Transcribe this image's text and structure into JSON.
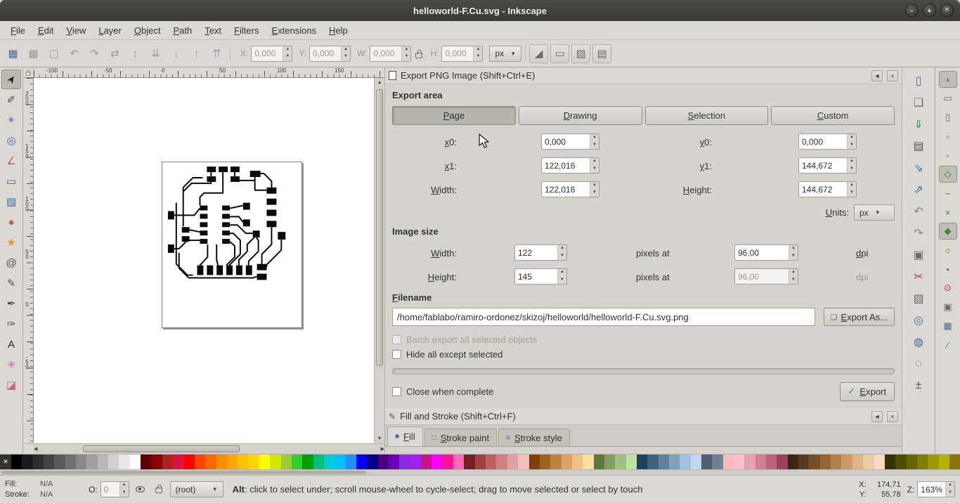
{
  "window": {
    "title": "helloworld-F.Cu.svg - Inkscape"
  },
  "titlebar": {
    "buttons": [
      {
        "name": "window-shade-button",
        "glyph": "⌄"
      },
      {
        "name": "window-maximize-button",
        "glyph": "▴"
      },
      {
        "name": "window-close-button",
        "glyph": "✕"
      }
    ]
  },
  "menu": {
    "items": [
      "File",
      "Edit",
      "View",
      "Layer",
      "Object",
      "Path",
      "Text",
      "Filters",
      "Extensions",
      "Help"
    ]
  },
  "command_bar": {
    "icons": [
      {
        "name": "select-all-icon",
        "glyph": "▦",
        "color": "#4a6a9a"
      },
      {
        "name": "select-all-layers-icon",
        "glyph": "▩",
        "color": "#9d9993"
      },
      {
        "name": "deselect-icon",
        "glyph": "▢",
        "color": "#9d9993"
      },
      {
        "name": "rotate-ccw-icon",
        "glyph": "↶",
        "color": "#9d9993"
      },
      {
        "name": "rotate-cw-icon",
        "glyph": "↷",
        "color": "#9d9993"
      },
      {
        "name": "flip-horizontal-icon",
        "glyph": "⇄",
        "color": "#9d9993"
      },
      {
        "name": "flip-vertical-icon",
        "glyph": "↕",
        "color": "#9d9993"
      },
      {
        "name": "lower-to-bottom-icon",
        "glyph": "⇊",
        "color": "#9aa4b4"
      },
      {
        "name": "lower-icon",
        "glyph": "↓",
        "color": "#9aa4b4"
      },
      {
        "name": "raise-icon",
        "glyph": "↑",
        "color": "#9aa4b4"
      },
      {
        "name": "raise-to-top-icon",
        "glyph": "⇈",
        "color": "#9aa4b4"
      }
    ],
    "x_label": "X:",
    "x_value": "0,000",
    "y_label": "Y:",
    "y_value": "0,000",
    "w_label": "W:",
    "w_value": "0,000",
    "h_label": "H:",
    "h_value": "0,000",
    "units_value": "px",
    "affect_buttons": [
      {
        "name": "transform-stroke-toggle",
        "glyph": "◢"
      },
      {
        "name": "transform-corners-toggle",
        "glyph": "▭"
      },
      {
        "name": "transform-gradient-toggle",
        "glyph": "▧"
      },
      {
        "name": "transform-pattern-toggle",
        "glyph": "▤"
      }
    ]
  },
  "toolbox": {
    "tools": [
      {
        "name": "selector-tool",
        "glyph": "➤",
        "color": "#222222",
        "active": true
      },
      {
        "name": "node-tool",
        "glyph": "✐",
        "color": "#33506a"
      },
      {
        "name": "tweak-tool",
        "glyph": "✴",
        "color": "#8a6ab0"
      },
      {
        "name": "zoom-tool",
        "glyph": "◎",
        "color": "#3a6ea5"
      },
      {
        "name": "measure-tool",
        "glyph": "∠",
        "color": "#c05a78"
      },
      {
        "name": "rectangle-tool",
        "glyph": "▭",
        "color": "#4a6a9a"
      },
      {
        "name": "box-3d-tool",
        "glyph": "▧",
        "color": "#4a6a9a"
      },
      {
        "name": "ellipse-tool",
        "glyph": "●",
        "color": "#c05a5a"
      },
      {
        "name": "star-tool",
        "glyph": "★",
        "color": "#d4a017"
      },
      {
        "name": "spiral-tool",
        "glyph": "@",
        "color": "#55524e"
      },
      {
        "name": "pencil-tool",
        "glyph": "✎",
        "color": "#55524e"
      },
      {
        "name": "pen-tool",
        "glyph": "✒",
        "color": "#55524e"
      },
      {
        "name": "calligraphy-tool",
        "glyph": "✑",
        "color": "#55524e"
      },
      {
        "name": "text-tool",
        "glyph": "A",
        "color": "#222222"
      },
      {
        "name": "spray-tool",
        "glyph": "✳",
        "color": "#b56aa0"
      },
      {
        "name": "eraser-tool",
        "glyph": "◪",
        "color": "#c06a8a"
      }
    ]
  },
  "rulers": {
    "horizontal": [
      "-100",
      "-50",
      "0",
      "50",
      "100",
      "150"
    ],
    "vertical": [
      "200",
      "150",
      "100",
      "50",
      "0",
      "-50"
    ]
  },
  "export_dialog": {
    "title": "Export PNG Image (Shift+Ctrl+E)",
    "section_export_area": "Export area",
    "area_buttons": [
      {
        "label": "Page",
        "active": true
      },
      {
        "label": "Drawing"
      },
      {
        "label": "Selection"
      },
      {
        "label": "Custom"
      }
    ],
    "x0_label": "x0:",
    "x0_value": "0,000",
    "y0_label": "y0:",
    "y0_value": "0,000",
    "x1_label": "x1:",
    "x1_value": "122,016",
    "y1_label": "y1:",
    "y1_value": "144,672",
    "width_label": "Width:",
    "width_value": "122,016",
    "height_label": "Height:",
    "height_value": "144,672",
    "units_label": "Units:",
    "units_value": "px",
    "section_image_size": "Image size",
    "img_width_label": "Width:",
    "img_width_value": "122",
    "img_height_label": "Height:",
    "img_height_value": "145",
    "pixels_at_label": "pixels at",
    "dpi_width_value": "96,00",
    "dpi_height_value": "96,00",
    "dpi_label": "dpi",
    "section_filename": "Filename",
    "filename_value": "/home/fablabo/ramiro-ordonez/skizoj/helloworld/helloworld-F.Cu.svg.png",
    "export_as_label": "Export As...",
    "batch_checkbox_label": "Batch export all selected objects",
    "hide_checkbox_label": "Hide all except selected",
    "close_checkbox_label": "Close when complete",
    "export_button_label": "Export"
  },
  "fill_stroke": {
    "title": "Fill and Stroke (Shift+Ctrl+F)",
    "tabs": [
      {
        "label": "Fill",
        "glyph": "■",
        "active": true
      },
      {
        "label": "Stroke paint",
        "glyph": "□"
      },
      {
        "label": "Stroke style",
        "glyph": "≡"
      }
    ]
  },
  "right_commands": {
    "buttons": [
      {
        "name": "new-document-button",
        "glyph": "▯",
        "color": "#4a6a9a"
      },
      {
        "name": "open-document-button",
        "glyph": "❏",
        "color": "#6a6a66"
      },
      {
        "name": "save-document-button",
        "glyph": "⇓",
        "color": "#3a8a3a"
      },
      {
        "name": "print-document-button",
        "glyph": "▤",
        "color": "#55524e"
      },
      {
        "name": "import-document-button",
        "glyph": "⇘",
        "color": "#3a6ea5"
      },
      {
        "name": "export-document-button",
        "glyph": "⇗",
        "color": "#3a6ea5"
      },
      {
        "name": "undo-button",
        "glyph": "↶",
        "color": "#8a8681"
      },
      {
        "name": "redo-button",
        "glyph": "↷",
        "color": "#8a8681"
      },
      {
        "name": "duplicate-button",
        "glyph": "▣",
        "color": "#6a6a66"
      },
      {
        "name": "cut-button",
        "glyph": "✂",
        "color": "#b03a3a"
      },
      {
        "name": "paste-button",
        "glyph": "▨",
        "color": "#6a6a66"
      },
      {
        "name": "zoom-page-button",
        "glyph": "◎",
        "color": "#4a6a9a"
      },
      {
        "name": "zoom-drawing-button",
        "glyph": "◍",
        "color": "#4a6a9a"
      },
      {
        "name": "zoom-selection-button",
        "glyph": "◌",
        "color": "#4a6a9a"
      },
      {
        "name": "zoom-adjust-button",
        "glyph": "±",
        "color": "#55524e"
      }
    ]
  },
  "snap_bar": {
    "buttons": [
      {
        "name": "snap-enable-toggle",
        "glyph": "+",
        "color": "#3a6ea5",
        "active": true
      },
      {
        "name": "snap-bbox-toggle",
        "glyph": "▭",
        "color": "#6a6a66"
      },
      {
        "name": "snap-bbox-edge-toggle",
        "glyph": "▯",
        "color": "#6a6a66"
      },
      {
        "name": "snap-bbox-corner-toggle",
        "glyph": "▫",
        "color": "#6a6a66"
      },
      {
        "name": "snap-bbox-midpoint-toggle",
        "glyph": "◦",
        "color": "#6a6a66"
      },
      {
        "name": "snap-nodes-toggle",
        "glyph": "◇",
        "color": "#3a8a3a",
        "active": true
      },
      {
        "name": "snap-path-toggle",
        "glyph": "~",
        "color": "#3a8a3a"
      },
      {
        "name": "snap-intersection-toggle",
        "glyph": "×",
        "color": "#3a8a3a"
      },
      {
        "name": "snap-cusp-node-toggle",
        "glyph": "◆",
        "color": "#3a8a3a",
        "active": true
      },
      {
        "name": "snap-smooth-node-toggle",
        "glyph": "○",
        "color": "#3a8a3a"
      },
      {
        "name": "snap-midpoint-toggle",
        "glyph": "•",
        "color": "#6a6a66"
      },
      {
        "name": "snap-center-toggle",
        "glyph": "⊙",
        "color": "#b03a3a"
      },
      {
        "name": "snap-page-toggle",
        "glyph": "▣",
        "color": "#6a6a66"
      },
      {
        "name": "snap-grid-toggle",
        "glyph": "▦",
        "color": "#3a6ea5"
      },
      {
        "name": "snap-guide-toggle",
        "glyph": "∕",
        "color": "#3a6ea5"
      }
    ]
  },
  "palette": {
    "none_glyph": "✕",
    "colors": [
      "#000000",
      "#1a1a1a",
      "#2e2e2e",
      "#444444",
      "#5a5a5a",
      "#707070",
      "#888888",
      "#a0a0a0",
      "#b8b8b8",
      "#d0d0d0",
      "#e8e8e8",
      "#ffffff",
      "#5c0000",
      "#8b0000",
      "#b22222",
      "#dc143c",
      "#ff0000",
      "#ff4500",
      "#ff6600",
      "#ff8c00",
      "#ffa500",
      "#ffc000",
      "#ffd700",
      "#ffff00",
      "#d4e600",
      "#9acd32",
      "#32cd32",
      "#00a000",
      "#00c080",
      "#00ced1",
      "#00bfff",
      "#1e90ff",
      "#0000ff",
      "#00008b",
      "#4b0082",
      "#6a00b8",
      "#8a2be2",
      "#a020f0",
      "#c71585",
      "#ff00ff",
      "#ff1493",
      "#ff69b4",
      "#7a1f1f",
      "#a04040",
      "#c06060",
      "#d08080",
      "#e0a0a0",
      "#f0c0c0",
      "#804000",
      "#a06020",
      "#c08040",
      "#e0a060",
      "#f0c080",
      "#ffe0a0",
      "#607840",
      "#80a060",
      "#a0c080",
      "#c0e0a0",
      "#204060",
      "#406080",
      "#6080a0",
      "#80a0c0",
      "#a0c0e0",
      "#c0d8f0",
      "#506070",
      "#708090",
      "#ffb6c1",
      "#ffc0cb",
      "#e8a0b0",
      "#d08090",
      "#c06080",
      "#a04060",
      "#3b2710",
      "#5c3a1e",
      "#7a4f28",
      "#996633",
      "#b38047",
      "#cc9966",
      "#e0b380",
      "#edc9a3",
      "#f5dcc0",
      "#333300",
      "#4d4d00",
      "#666600",
      "#808000",
      "#999900",
      "#b3b300",
      "#8a7500"
    ]
  },
  "statusbar": {
    "fill_label": "Fill:",
    "fill_value": "N/A",
    "stroke_label": "Stroke:",
    "stroke_value": "N/A",
    "opacity_label": "O:",
    "opacity_value": "0",
    "layer_value": "(root)",
    "message_prefix": "Alt",
    "message_rest": ": click to select under; scroll mouse-wheel to cycle-select; drag to move selected or select by touch",
    "x_label": "X:",
    "x_value": "174,71",
    "y_label": "Y:",
    "y_value": "55,78",
    "zoom_label": "Z:",
    "zoom_value": "163%"
  },
  "icons": {
    "dropdown": "▼",
    "dock_arrow": "◄",
    "close": "×",
    "export_check": "✓",
    "export_as": "❏",
    "fill_stroke_pencil": "✎"
  }
}
